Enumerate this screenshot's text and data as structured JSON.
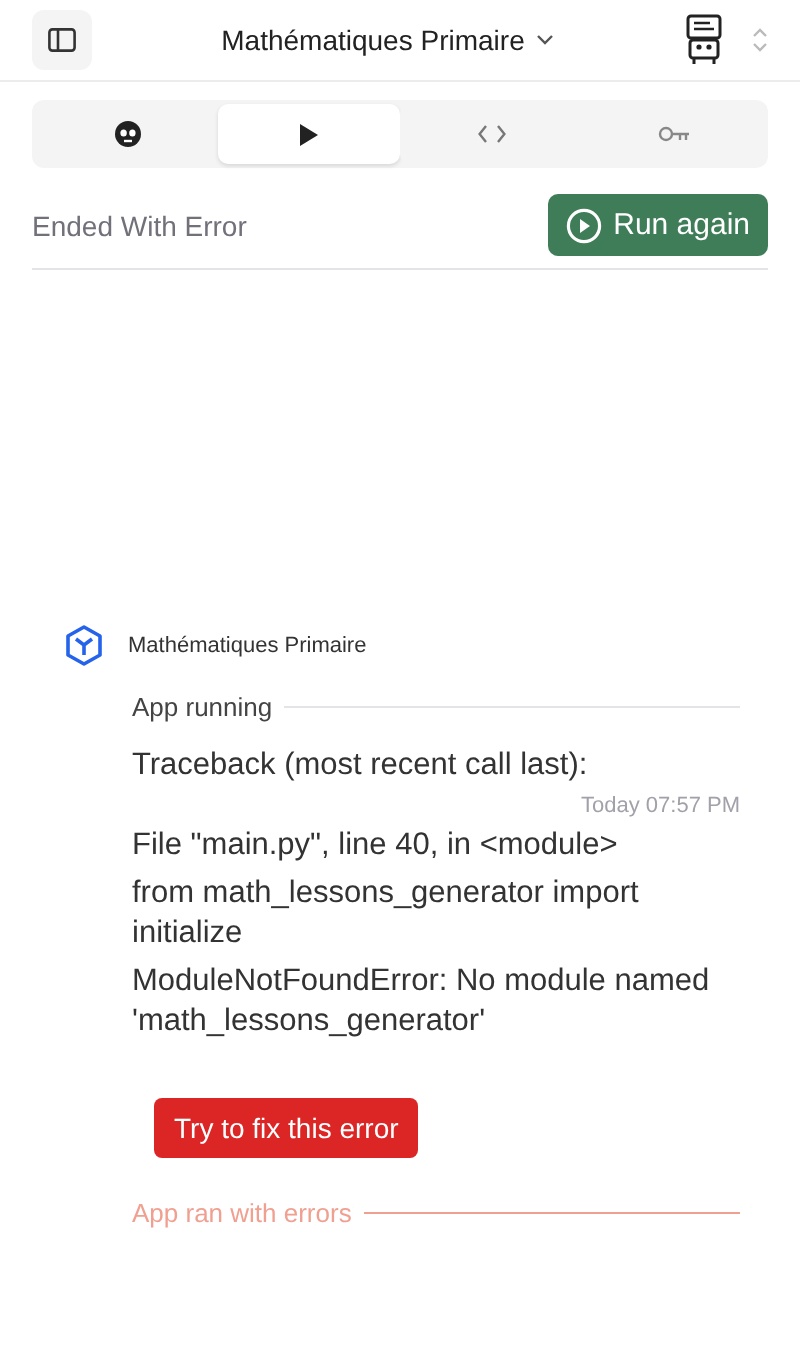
{
  "header": {
    "title": "Mathématiques Primaire"
  },
  "tabs": [
    {
      "kind": "face",
      "selected": false
    },
    {
      "kind": "play",
      "selected": true
    },
    {
      "kind": "code",
      "selected": false
    },
    {
      "kind": "key",
      "selected": false
    }
  ],
  "status": {
    "label": "Ended With Error",
    "button": "Run again"
  },
  "message": {
    "author": "Mathématiques Primaire",
    "start_label": "App running",
    "lines": [
      "Traceback (most recent call last):",
      "File \"main.py\", line 40, in <module>",
      "from math_lessons_generator import initialize",
      "ModuleNotFoundError: No module named 'math_lessons_generator'"
    ],
    "time": "Today 07:57 PM",
    "fix_button": "Try to fix this error",
    "end_label": "App ran with errors"
  }
}
